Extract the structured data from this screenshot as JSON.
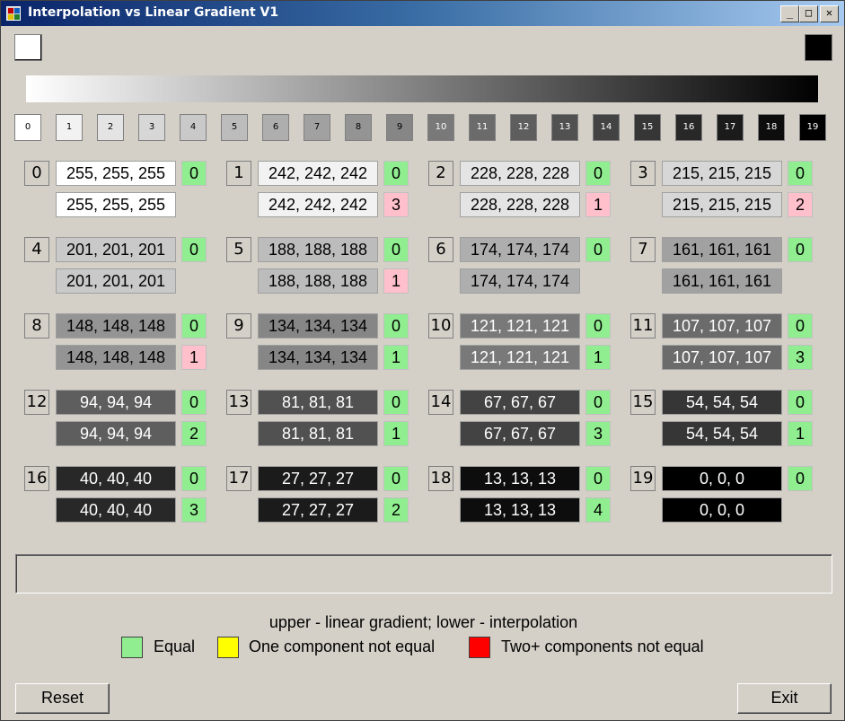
{
  "window": {
    "title": "Interpolation vs Linear Gradient V1",
    "minimize_glyph": "_",
    "maximize_glyph": "□",
    "close_glyph": "✕"
  },
  "endpoints": {
    "start_color": "#ffffff",
    "end_color": "#000000"
  },
  "steps": [
    "0",
    "1",
    "2",
    "3",
    "4",
    "5",
    "6",
    "7",
    "8",
    "9",
    "10",
    "11",
    "12",
    "13",
    "14",
    "15",
    "16",
    "17",
    "18",
    "19"
  ],
  "cells": [
    {
      "index": "0",
      "linear": "255, 255, 255",
      "linear_score": "0",
      "interp": "255, 255, 255",
      "interp_score": ""
    },
    {
      "index": "1",
      "linear": "242, 242, 242",
      "linear_score": "0",
      "interp": "242, 242, 242",
      "interp_score": "3"
    },
    {
      "index": "2",
      "linear": "228, 228, 228",
      "linear_score": "0",
      "interp": "228, 228, 228",
      "interp_score": "1"
    },
    {
      "index": "3",
      "linear": "215, 215, 215",
      "linear_score": "0",
      "interp": "215, 215, 215",
      "interp_score": "2"
    },
    {
      "index": "4",
      "linear": "201, 201, 201",
      "linear_score": "0",
      "interp": "201, 201, 201",
      "interp_score": ""
    },
    {
      "index": "5",
      "linear": "188, 188, 188",
      "linear_score": "0",
      "interp": "188, 188, 188",
      "interp_score": "1"
    },
    {
      "index": "6",
      "linear": "174, 174, 174",
      "linear_score": "0",
      "interp": "174, 174, 174",
      "interp_score": ""
    },
    {
      "index": "7",
      "linear": "161, 161, 161",
      "linear_score": "0",
      "interp": "161, 161, 161",
      "interp_score": ""
    },
    {
      "index": "8",
      "linear": "148, 148, 148",
      "linear_score": "0",
      "interp": "148, 148, 148",
      "interp_score": "1"
    },
    {
      "index": "9",
      "linear": "134, 134, 134",
      "linear_score": "0",
      "interp": "134, 134, 134",
      "interp_score": "1"
    },
    {
      "index": "10",
      "linear": "121, 121, 121",
      "linear_score": "0",
      "interp": "121, 121, 121",
      "interp_score": "1"
    },
    {
      "index": "11",
      "linear": "107, 107, 107",
      "linear_score": "0",
      "interp": "107, 107, 107",
      "interp_score": "3"
    },
    {
      "index": "12",
      "linear": "94,  94,  94",
      "linear_score": "0",
      "interp": "94,  94,  94",
      "interp_score": "2"
    },
    {
      "index": "13",
      "linear": "81,  81,  81",
      "linear_score": "0",
      "interp": "81,  81,  81",
      "interp_score": "1"
    },
    {
      "index": "14",
      "linear": "67,  67,  67",
      "linear_score": "0",
      "interp": "67,  67,  67",
      "interp_score": "3"
    },
    {
      "index": "15",
      "linear": "54,  54,  54",
      "linear_score": "0",
      "interp": "54,  54,  54",
      "interp_score": "1"
    },
    {
      "index": "16",
      "linear": "40,  40,  40",
      "linear_score": "0",
      "interp": "40,  40,  40",
      "interp_score": "3"
    },
    {
      "index": "17",
      "linear": "27,  27,  27",
      "linear_score": "0",
      "interp": "27,  27,  27",
      "interp_score": "2"
    },
    {
      "index": "18",
      "linear": "13,  13,  13",
      "linear_score": "0",
      "interp": "13,  13,  13",
      "interp_score": "4"
    },
    {
      "index": "19",
      "linear": "0,  0,  0",
      "linear_score": "0",
      "interp": "0,  0,  0",
      "interp_score": ""
    }
  ],
  "score_colors": {
    "green": "#90ee90",
    "pink": "#ffc0cb"
  },
  "interp_score_color_keys": [
    "",
    "pink",
    "pink",
    "pink",
    "",
    "pink",
    "",
    "",
    "pink",
    "green",
    "green",
    "green",
    "green",
    "green",
    "green",
    "green",
    "green",
    "green",
    "green",
    ""
  ],
  "legend": {
    "caption": "upper - linear gradient; lower - interpolation",
    "items": [
      {
        "label": "Equal",
        "color": "#90ee90"
      },
      {
        "label": "One component not equal",
        "color": "#ffff00"
      },
      {
        "label": "Two+ components not equal",
        "color": "#ff0000"
      }
    ]
  },
  "buttons": {
    "reset": "Reset",
    "exit": "Exit"
  }
}
